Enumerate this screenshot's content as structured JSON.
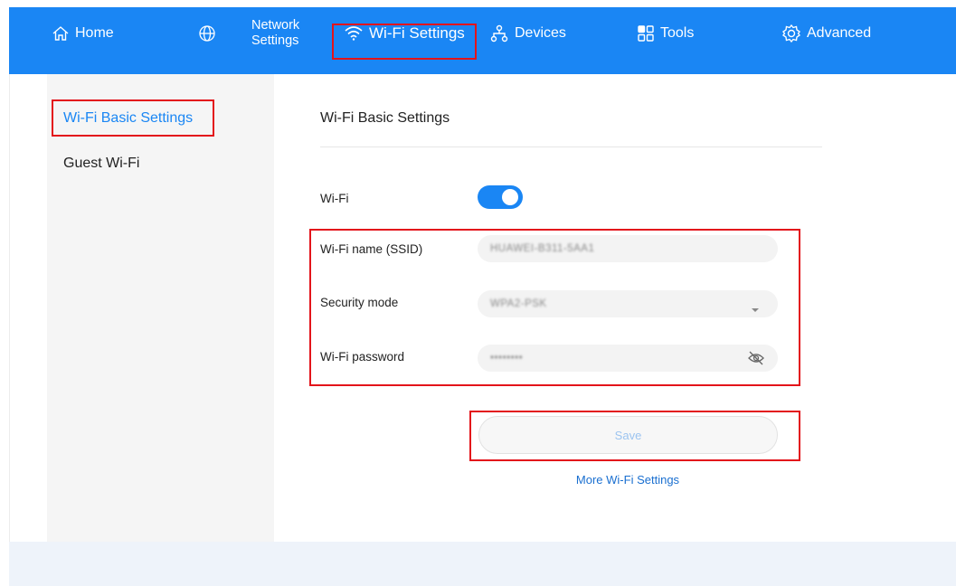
{
  "nav": {
    "home_label": "Home",
    "network_label_line1": "Network",
    "network_label_line2": "Settings",
    "wifi_label": "Wi-Fi Settings",
    "devices_label": "Devices",
    "tools_label": "Tools",
    "advanced_label": "Advanced",
    "active": "Wi-Fi Settings"
  },
  "sidebar": {
    "items": [
      {
        "label": "Wi-Fi Basic Settings",
        "active": true
      },
      {
        "label": "Guest Wi-Fi",
        "active": false
      }
    ]
  },
  "main": {
    "title": "Wi-Fi Basic Settings",
    "wifi": {
      "label": "Wi-Fi",
      "enabled": true
    },
    "ssid": {
      "label": "Wi-Fi name (SSID)",
      "value": "HUAWEI-B311-5AA1"
    },
    "security": {
      "label": "Security mode",
      "value": "WPA2-PSK"
    },
    "password": {
      "label": "Wi-Fi password",
      "value": "••••••••"
    },
    "save_label": "Save",
    "more_link": "More Wi-Fi Settings"
  },
  "colors": {
    "accent": "#1a86f4",
    "highlight": "#e3141b"
  }
}
